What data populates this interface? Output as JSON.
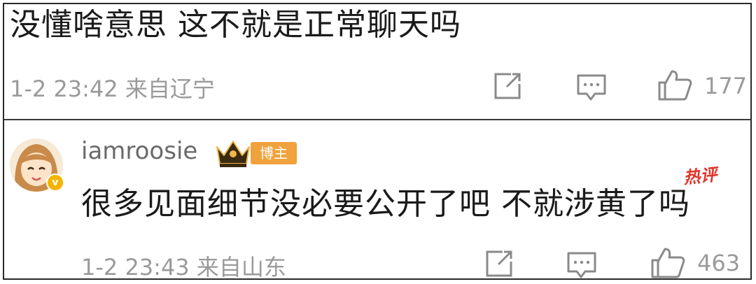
{
  "comment1": {
    "text": "没懂啥意思 这不就是正常聊天吗",
    "meta": "1-2 23:42 来自辽宁",
    "like_count": "177"
  },
  "comment2": {
    "username": "iamroosie",
    "author_badge": "博主",
    "hot_tag": "热评",
    "text": "很多见面细节没必要公开了吧 不就涉黄了吗",
    "meta": "1-2 23:43 来自山东",
    "like_count": "463"
  },
  "colors": {
    "meta_gray": "#9a9a9a",
    "author_badge": "#f0a23c",
    "hot_tag": "#e0352b",
    "verified_badge": "#f5b400"
  }
}
